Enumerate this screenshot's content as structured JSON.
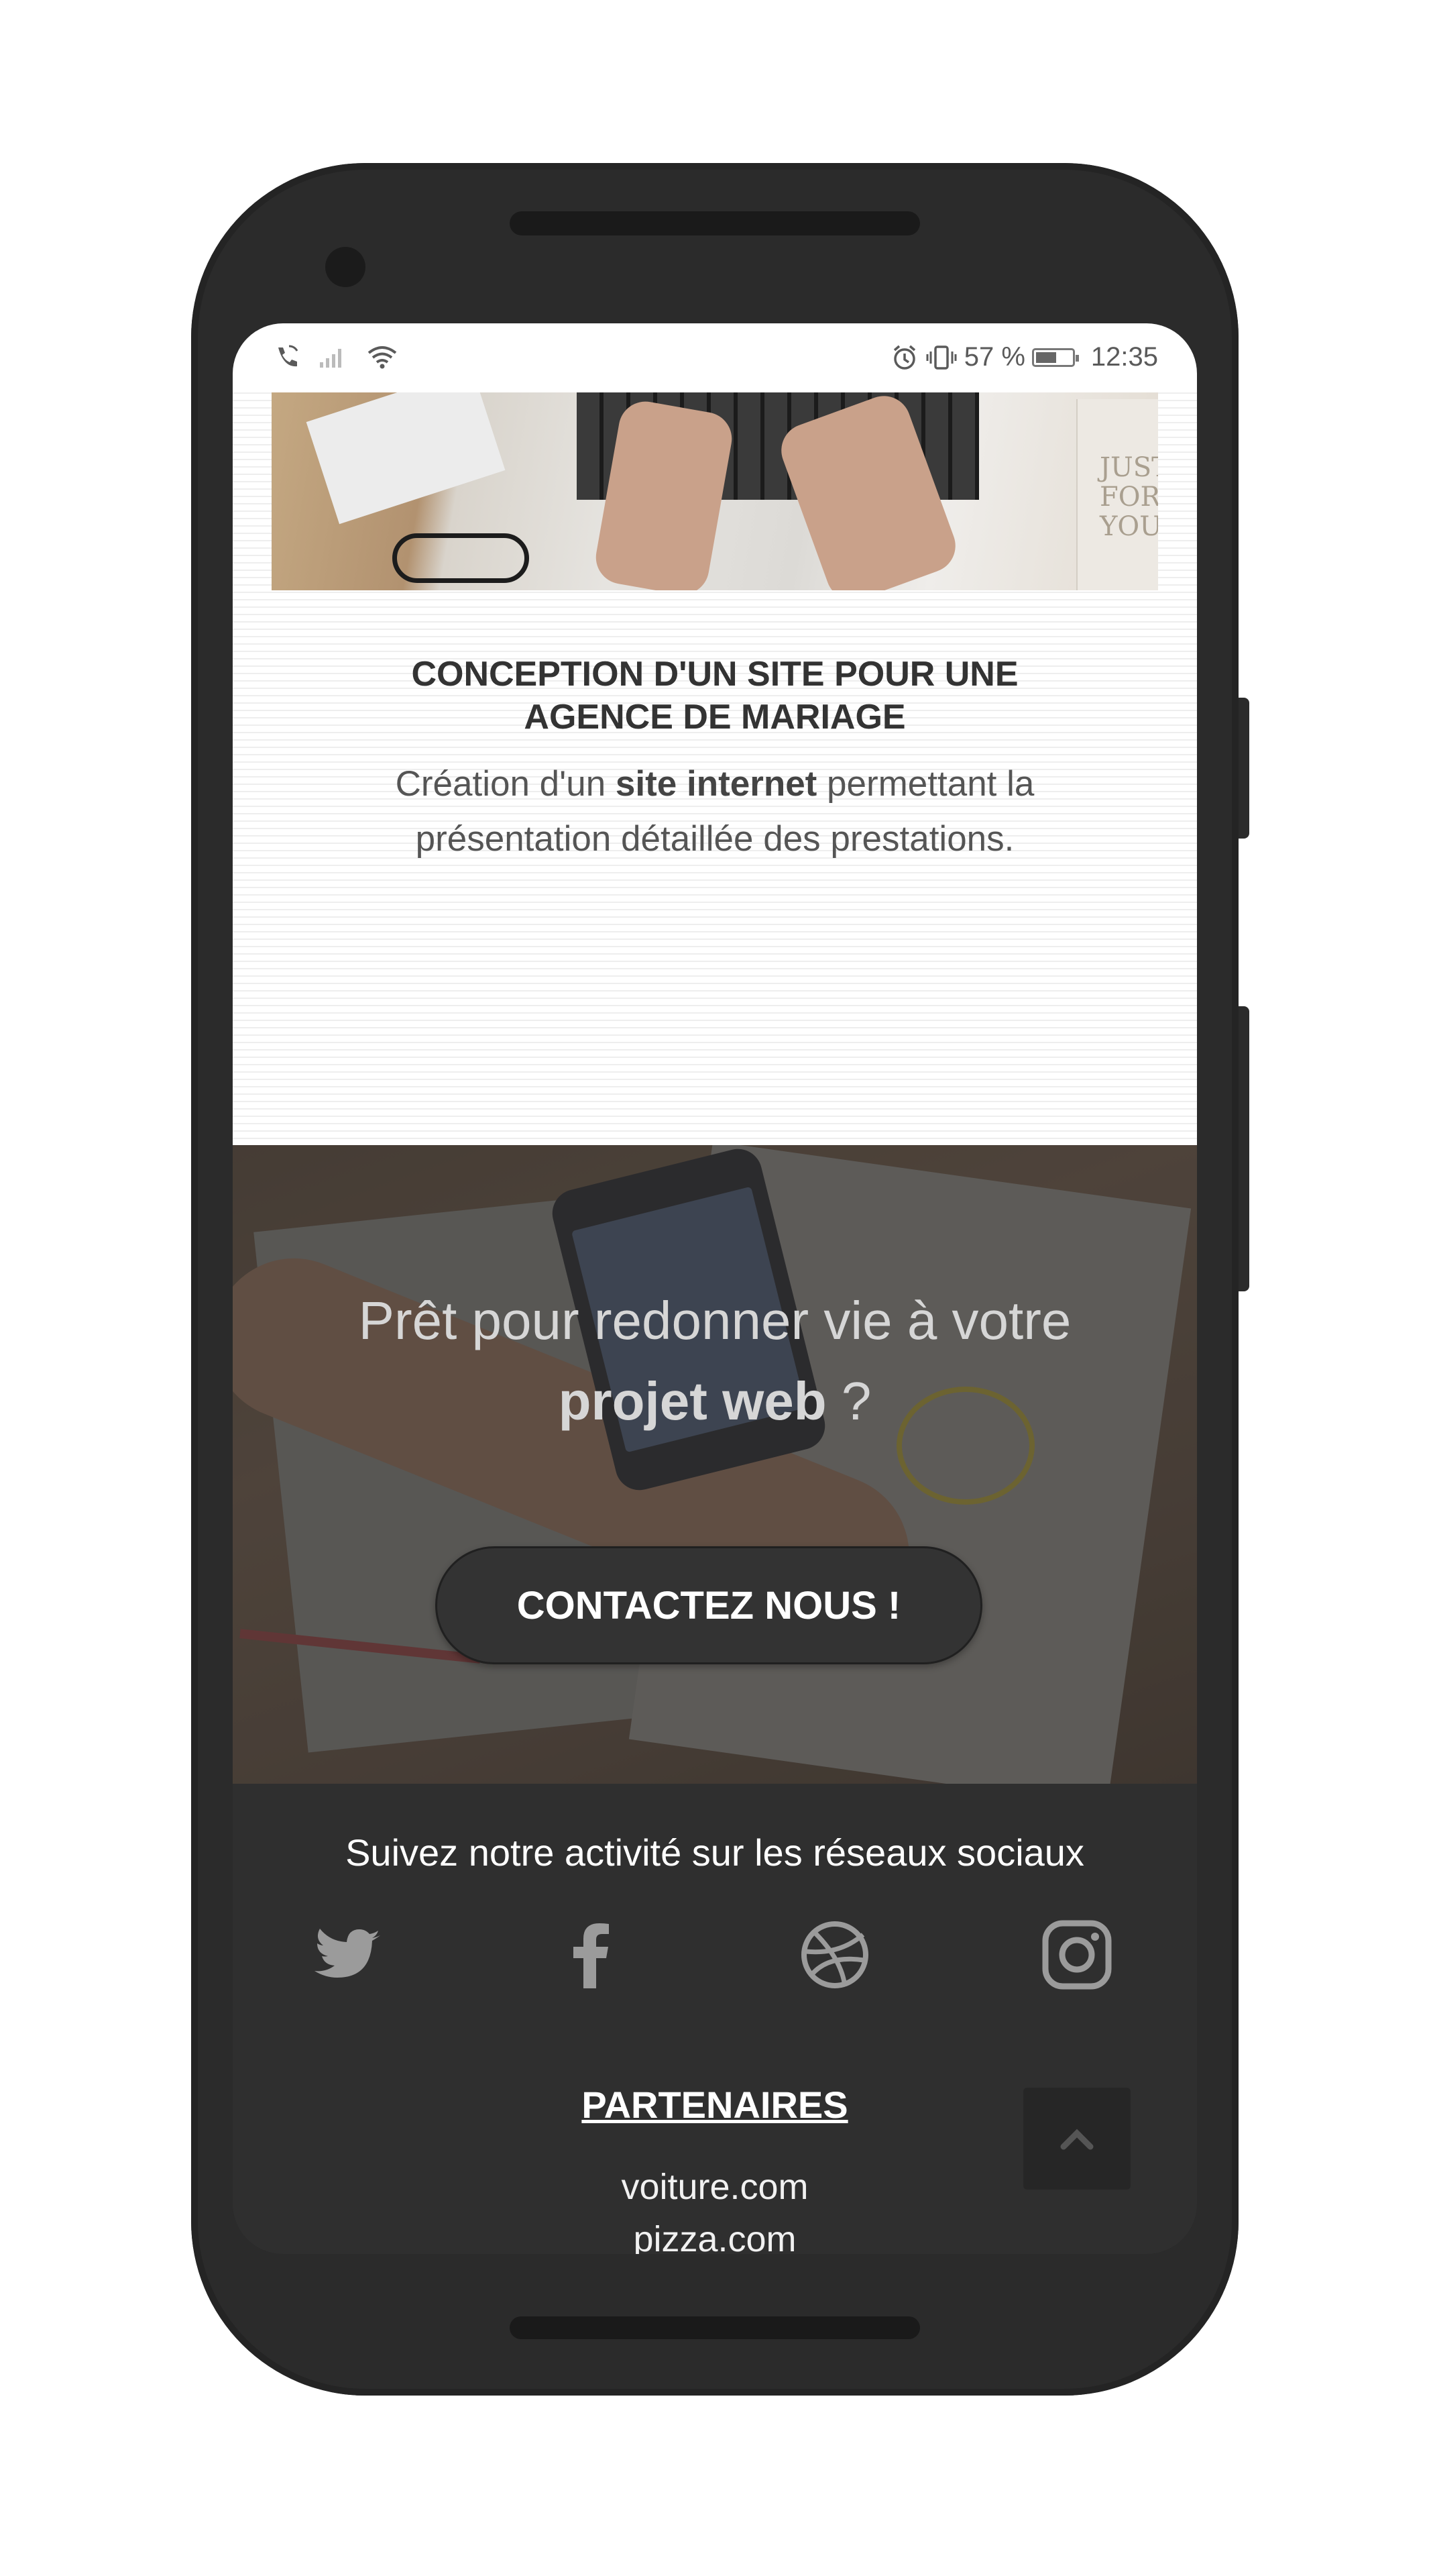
{
  "status_bar": {
    "battery_text": "57 %",
    "battery_level": 0.57,
    "time": "12:35",
    "icons": [
      "phone-wifi-call-icon",
      "signal-icon",
      "wifi-icon",
      "alarm-icon",
      "vibrate-icon",
      "battery-icon"
    ]
  },
  "project_card": {
    "image": "laptop-hands-photo",
    "title_line1": "CONCEPTION D'UN SITE POUR UNE",
    "title_line2": "AGENCE DE MARIAGE",
    "desc_part1": "Création d'un ",
    "desc_bold": "site internet",
    "desc_part2": " permettant la",
    "desc_line2": "présentation détaillée des prestations."
  },
  "cta": {
    "line1": "Prêt pour redonner vie à votre",
    "bold": "projet web",
    "suffix": " ?",
    "button_label": "CONTACTEZ NOUS !"
  },
  "footer": {
    "follow_text": "Suivez notre activité sur les réseaux sociaux",
    "social_icons": [
      "twitter-icon",
      "facebook-icon",
      "dribbble-icon",
      "instagram-icon"
    ],
    "partners_title": "PARTENAIRES",
    "partners": [
      "voiture.com",
      "pizza.com"
    ]
  },
  "colors": {
    "footer_bg": "#2f2f2f",
    "button_bg": "#333333",
    "icon_gray": "#9b9b9b"
  }
}
